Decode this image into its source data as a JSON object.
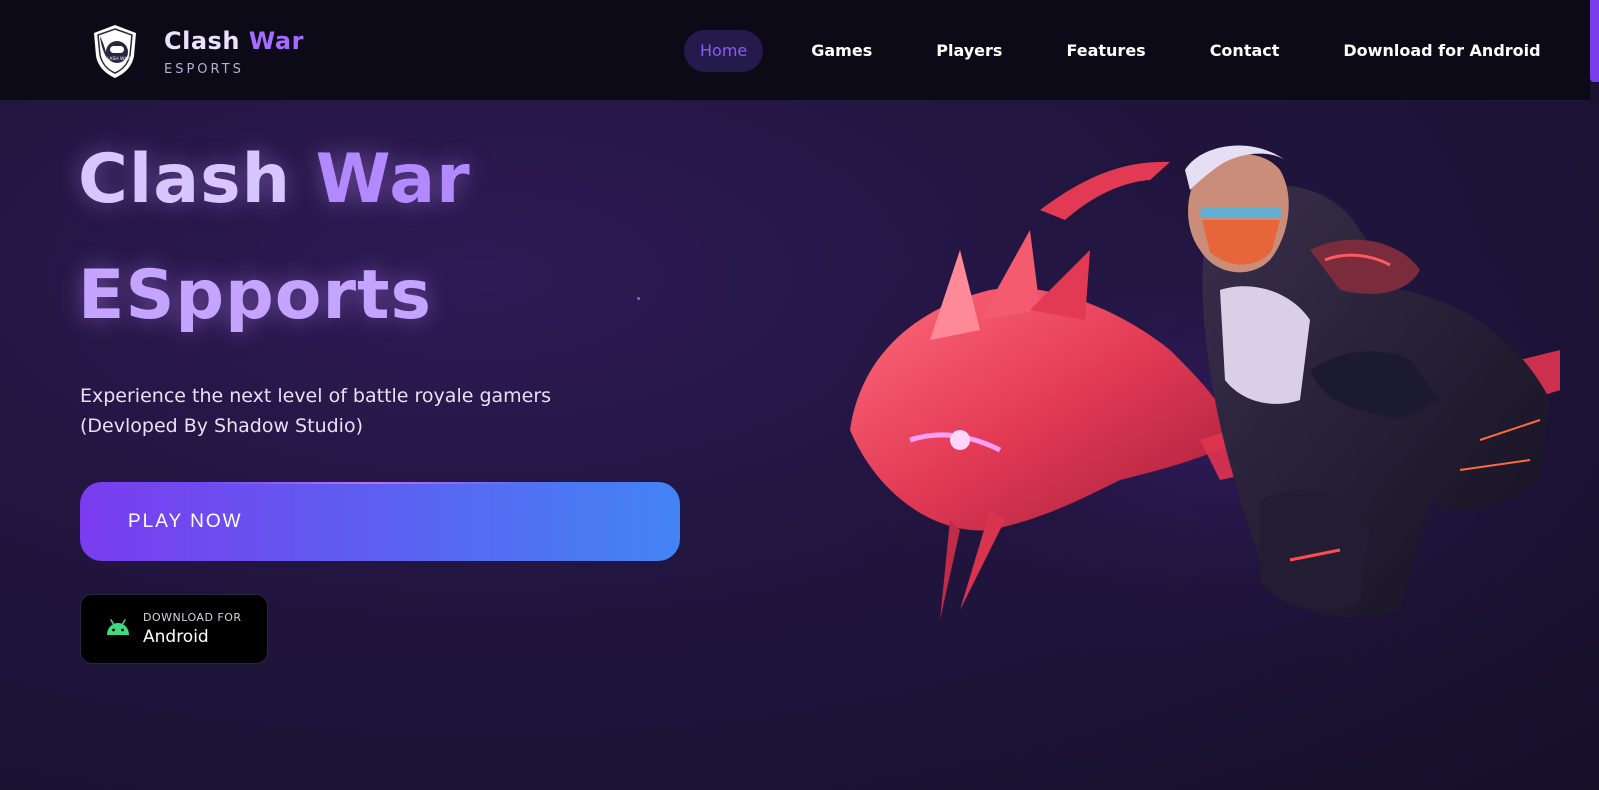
{
  "brand": {
    "title_part1": "Clash",
    "title_part2": "War",
    "subtitle": "ESPORTS",
    "logo_icon": "shield-gamepad-icon",
    "logo_text": "CLASH WAR"
  },
  "nav": {
    "items": [
      {
        "label": "Home",
        "active": true
      },
      {
        "label": "Games",
        "active": false
      },
      {
        "label": "Players",
        "active": false
      },
      {
        "label": "Features",
        "active": false
      },
      {
        "label": "Contact",
        "active": false
      },
      {
        "label": "Download for Android",
        "active": false
      }
    ]
  },
  "hero": {
    "title_line1_a": "Clash",
    "title_line1_b": "War",
    "title_line2": "ESpports",
    "description_line1": "Experience the next level of battle royale gamers",
    "description_line2": "(Devloped By Shadow Studio)",
    "play_button": "PLAY NOW",
    "android_small": "DOWNLOAD FOR",
    "android_big": "Android",
    "android_icon": "android-icon",
    "art": "masked-warrior-with-crystal-dragon-illustration"
  },
  "colors": {
    "accent": "#8a5cf6",
    "header_bg": "#0c0a17",
    "page_bg": "#221540",
    "button_start": "#7b3cf0",
    "button_end": "#4384f5",
    "android_green": "#3ddc84"
  }
}
